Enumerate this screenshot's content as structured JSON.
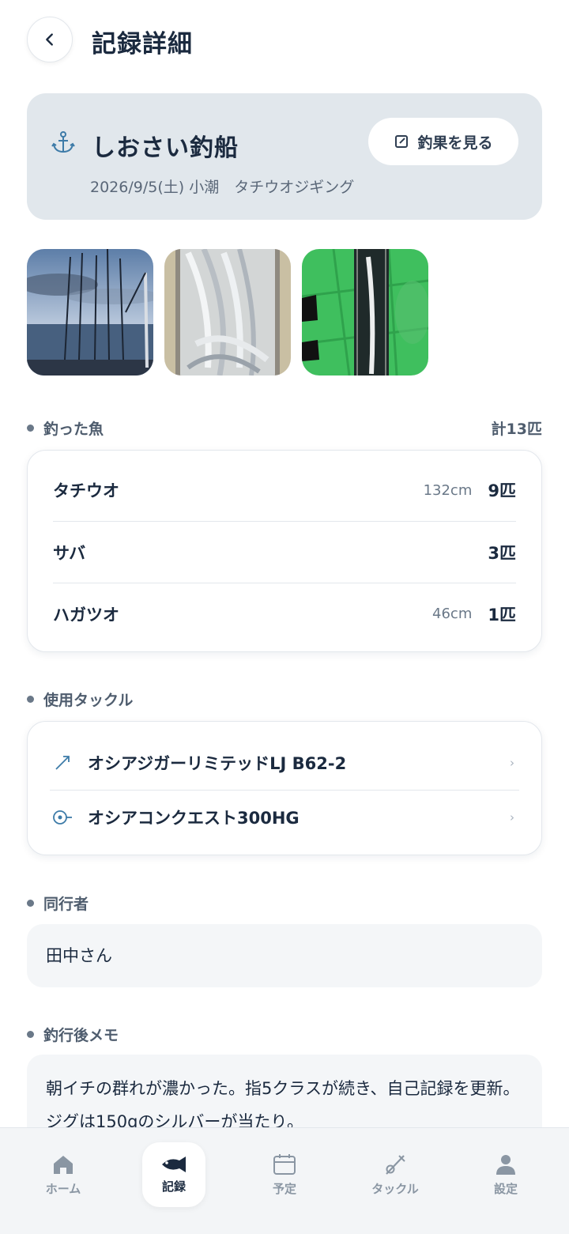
{
  "header": {
    "title": "記録詳細"
  },
  "trip": {
    "boat_name": "しおさい釣船",
    "catch_button_label": "釣果を見る",
    "meta": "2026/9/5(土) 小潮　タチウオジギング"
  },
  "photos": [
    "boat-sea-photo",
    "fish-cooler-photo",
    "fish-measure-photo"
  ],
  "fish_section": {
    "label": "釣った魚",
    "total": "計13匹",
    "items": [
      {
        "name": "タチウオ",
        "size": "132cm",
        "count": "9匹"
      },
      {
        "name": "サバ",
        "size": "",
        "count": "3匹"
      },
      {
        "name": "ハガツオ",
        "size": "46cm",
        "count": "1匹"
      }
    ]
  },
  "tackle_section": {
    "label": "使用タックル",
    "items": [
      {
        "name": "オシアジガーリミテッドLJ B62-2",
        "icon": "rod-icon"
      },
      {
        "name": "オシアコンクエスト300HG",
        "icon": "reel-icon"
      }
    ]
  },
  "companion_section": {
    "label": "同行者",
    "value": "田中さん"
  },
  "memo_section": {
    "label": "釣行後メモ",
    "text": "朝イチの群れが濃かった。指5クラスが続き、自己記録を更新。ジグは150gのシルバーが当たり。"
  },
  "tabbar": {
    "items": [
      {
        "label": "ホーム",
        "icon": "home-icon",
        "active": false
      },
      {
        "label": "記録",
        "icon": "fish-icon",
        "active": true
      },
      {
        "label": "予定",
        "icon": "calendar-icon",
        "active": false
      },
      {
        "label": "タックル",
        "icon": "rod-icon",
        "active": false
      },
      {
        "label": "設定",
        "icon": "user-icon",
        "active": false
      }
    ]
  },
  "colors": {
    "accent": "#3d7ba8",
    "card_bg": "#e1e7ec",
    "text": "#1b2a3f"
  }
}
